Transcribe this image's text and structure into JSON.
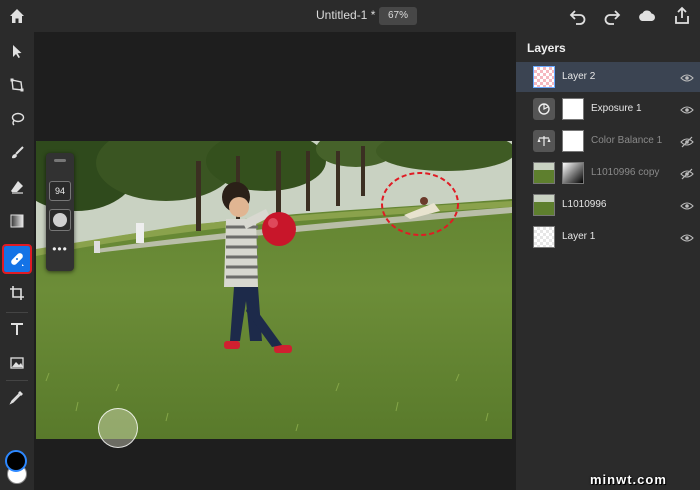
{
  "header": {
    "document_title": "Untitled-1 *",
    "zoom": "67%",
    "icons": [
      "home-icon",
      "undo-icon",
      "redo-icon",
      "cloud-icon",
      "share-icon"
    ]
  },
  "toolbar": {
    "tools": [
      "select-tool",
      "transform-tool",
      "lasso-tool",
      "brush-tool",
      "eraser-tool",
      "gradient-tool",
      "healing-brush-tool",
      "crop-tool",
      "type-tool",
      "place-image-tool",
      "eyedropper-tool"
    ],
    "active_tool": "healing-brush-tool",
    "foreground_color": "#000000",
    "background_color": "#ffffff",
    "accent_color": "#1473e6",
    "highlight_color": "#e01b24"
  },
  "brush_options": {
    "size": "94",
    "more": "•••"
  },
  "layers_panel": {
    "title": "Layers",
    "layers": [
      {
        "name": "Layer 2",
        "visible": true,
        "selected": true,
        "kind": "pixel"
      },
      {
        "name": "Exposure 1",
        "visible": true,
        "selected": false,
        "kind": "adjustment"
      },
      {
        "name": "Color Balance 1",
        "visible": false,
        "selected": false,
        "kind": "adjustment"
      },
      {
        "name": "L1010996 copy",
        "visible": false,
        "selected": false,
        "kind": "image-with-mask"
      },
      {
        "name": "L1010996",
        "visible": true,
        "selected": false,
        "kind": "image"
      },
      {
        "name": "Layer 1",
        "visible": true,
        "selected": false,
        "kind": "pixel"
      }
    ]
  },
  "watermark": "minwt.com"
}
